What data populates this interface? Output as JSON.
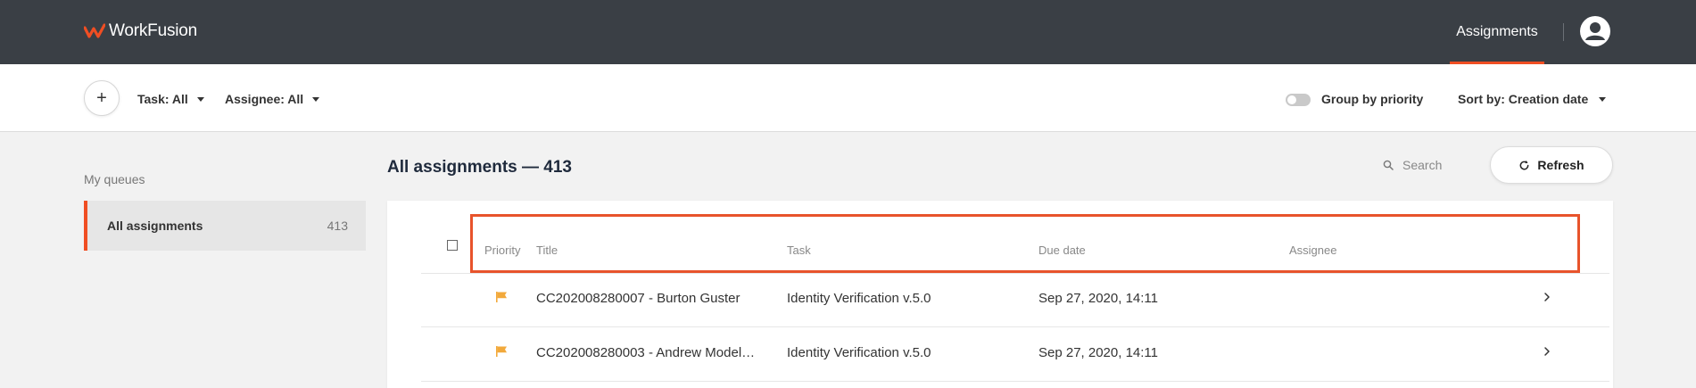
{
  "header": {
    "brand": "WorkFusion",
    "nav_item": "Assignments",
    "icons": {
      "logo": "workfusion-logo-icon",
      "user": "user-account-icon"
    },
    "accent_color": "#f04e23",
    "bg_color": "#3a3f45"
  },
  "toolbar": {
    "add_label": "+",
    "task_filter": "Task: All",
    "assignee_filter": "Assignee: All",
    "group_by_label": "Group by priority",
    "group_by_enabled": false,
    "sort_label": "Sort by: Creation date"
  },
  "sidebar": {
    "section_label": "My queues",
    "queues": [
      {
        "name": "All assignments",
        "count": "413"
      }
    ]
  },
  "main": {
    "title": "All assignments — 413",
    "search_placeholder": "Search",
    "refresh_label": "Refresh"
  },
  "table": {
    "columns": [
      "Priority",
      "Title",
      "Task",
      "Due date",
      "Assignee"
    ],
    "rows": [
      {
        "priority_icon": "flag-icon",
        "title": "CC202008280007 - Burton Guster",
        "task": "Identity Verification v.5.0",
        "due": "Sep 27, 2020, 14:11",
        "assignee": ""
      },
      {
        "priority_icon": "flag-icon",
        "title": "CC202008280003 - Andrew Model…",
        "task": "Identity Verification v.5.0",
        "due": "Sep 27, 2020, 14:11",
        "assignee": ""
      }
    ],
    "flag_color": "#f2a93b",
    "highlight_color": "#e8532b"
  }
}
